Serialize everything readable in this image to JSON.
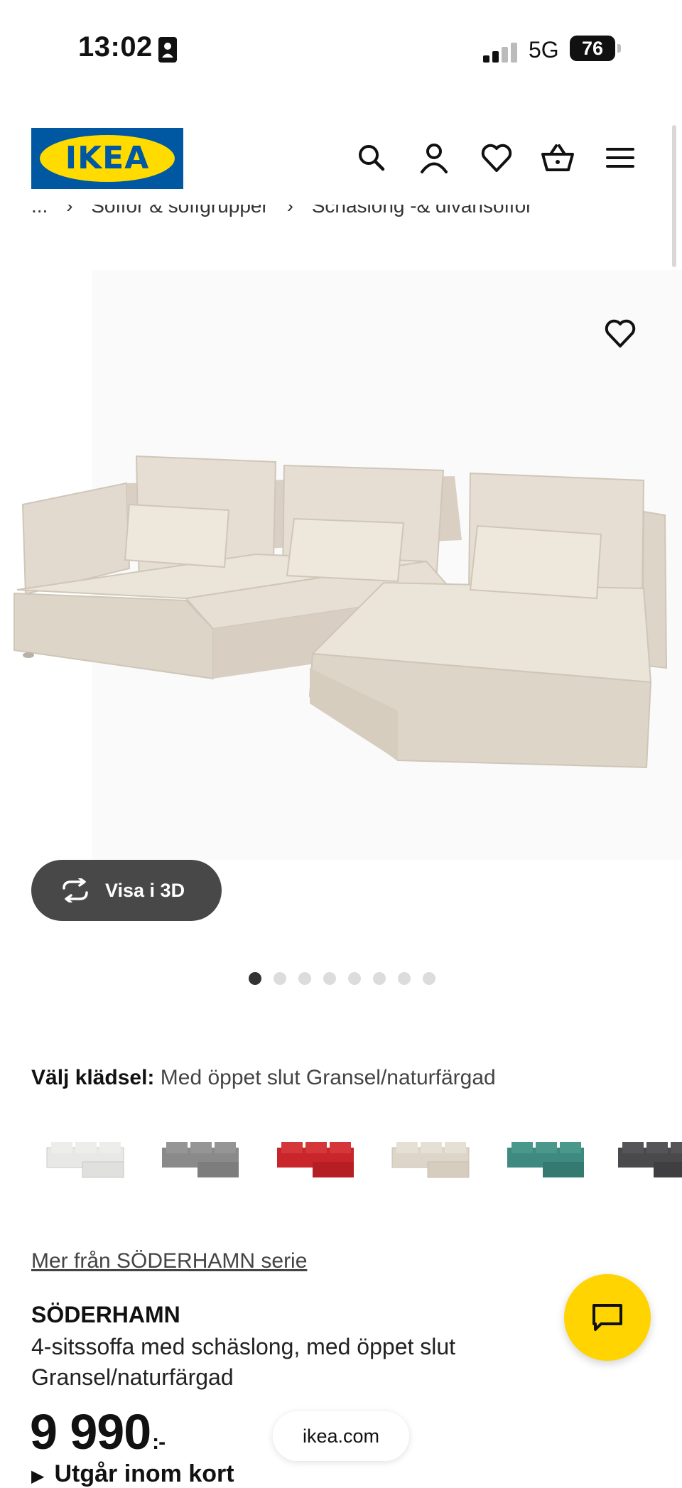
{
  "status_bar": {
    "time": "13:02",
    "network": "5G",
    "battery": "76"
  },
  "header": {
    "logo_text": "IKEA"
  },
  "breadcrumb": {
    "items": [
      "...",
      "Soffor & soffgrupper",
      "Schäslong -& divansoffor"
    ]
  },
  "gallery": {
    "view_3d_label": "Visa i 3D",
    "dot_count": 8,
    "active_dot": 0
  },
  "upholstery": {
    "label": "Välj klädsel:",
    "value": "Med öppet slut Gransel/naturfärgad",
    "swatches": [
      {
        "name": "white",
        "color": "#e8e8e6"
      },
      {
        "name": "grey",
        "color": "#8a8a8a"
      },
      {
        "name": "red",
        "color": "#c8262b"
      },
      {
        "name": "natural",
        "color": "#ddd5c8"
      },
      {
        "name": "turquoise",
        "color": "#3e8a80"
      },
      {
        "name": "dark-grey",
        "color": "#4a4a4c"
      }
    ]
  },
  "product": {
    "series_link": "Mer från SÖDERHAMN serie",
    "name": "SÖDERHAMN",
    "description": "4-sitssoffa med schäslong, med öppet slut Gransel/naturfärgad",
    "price": "9 990",
    "price_suffix": ":-",
    "availability": "Utgår inom kort"
  },
  "browser": {
    "url": "ikea.com"
  },
  "colors": {
    "brand_blue": "#0058a3",
    "brand_yellow": "#ffdb00",
    "chat_yellow": "#ffd400"
  }
}
